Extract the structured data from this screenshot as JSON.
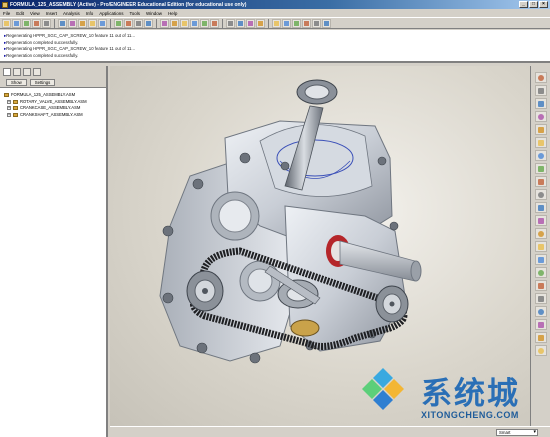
{
  "window": {
    "title": "FORMULA_125_ASSEMBLY (Active) - Pro/ENGINEER Educational Edition (for educational use only)",
    "buttons": [
      "_",
      "□",
      "×"
    ]
  },
  "menu": [
    "File",
    "Edit",
    "View",
    "Insert",
    "Analysis",
    "Info",
    "Applications",
    "Tools",
    "Window",
    "Help"
  ],
  "messages": [
    "Regenerating HPPR_SGC_CAP_SCREW_10 feature 11 out of 11...",
    "Regeneration completed successfully.",
    "Regenerating HPPR_SGC_CAP_SCREW_10 feature 11 out of 11...",
    "Regeneration completed successfully."
  ],
  "nav": {
    "buttons": [
      "Show",
      "Settings"
    ],
    "tree": [
      {
        "label": "FORMULA_125_ASSEMBLY.ASM",
        "level": 0
      },
      {
        "label": "ROTARY_VALVE_ASSEMBLY.ASM",
        "level": 1
      },
      {
        "label": "CRANKCASE_ASSEMBLY.ASM",
        "level": 1
      },
      {
        "label": "CRANKSHAFT_ASSEMBLY.ASM",
        "level": 1
      }
    ]
  },
  "status": {
    "filter": "Smart"
  },
  "watermark": {
    "title": "系统城",
    "subtitle": "XITONGCHENG.COM"
  },
  "icons": {
    "toolbar": [
      "new-icon",
      "open-icon",
      "save-icon",
      "print-icon",
      "email-icon",
      "undo-icon",
      "redo-icon",
      "cut-icon",
      "copy-icon",
      "paste-icon",
      "regenerate-icon",
      "find-icon",
      "select-icon",
      "repaint-icon",
      "zoom-in-icon",
      "zoom-out-icon",
      "refit-icon",
      "orient-icon",
      "saved-views-icon",
      "layers-icon",
      "wireframe-icon",
      "hidden-line-icon",
      "no-hidden-icon",
      "shading-icon",
      "datum-planes-icon",
      "datum-axes-icon",
      "datum-points-icon",
      "csys-icon",
      "spin-center-icon",
      "help-icon"
    ],
    "right_toolbar": [
      "sketch-icon",
      "plane-icon",
      "axis-icon",
      "curve-icon",
      "point-icon",
      "csys-icon",
      "analysis-icon",
      "extrude-icon",
      "revolve-icon",
      "variable-sweep-icon",
      "blend-icon",
      "hole-icon",
      "round-icon",
      "chamfer-icon",
      "rib-icon",
      "draft-icon",
      "shell-icon",
      "mirror-icon",
      "merge-icon",
      "trim-icon",
      "pattern-icon",
      "assemble-icon"
    ]
  },
  "colors": {
    "titlebar": "#0a246a",
    "accent": "#2a6fb6",
    "model_body": "#d7dce3",
    "model_highlight": "#b5262a"
  }
}
